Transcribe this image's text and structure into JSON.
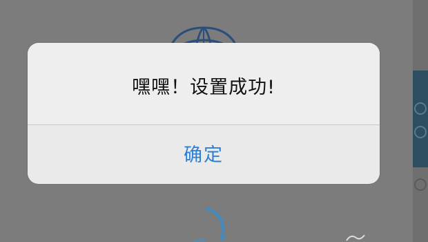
{
  "alert": {
    "title": "嘿嘿！设置成功!",
    "confirm_label": "确定"
  },
  "colors": {
    "overlay_bg": "#7c7c7c",
    "dialog_bg": "#eeeeee",
    "title_text": "#111111",
    "button_text": "#2c7fd6",
    "divider": "#c9c9c9"
  },
  "icons": {
    "background_top": "globe-icon",
    "background_bottom": "loading-spinner-icon"
  }
}
